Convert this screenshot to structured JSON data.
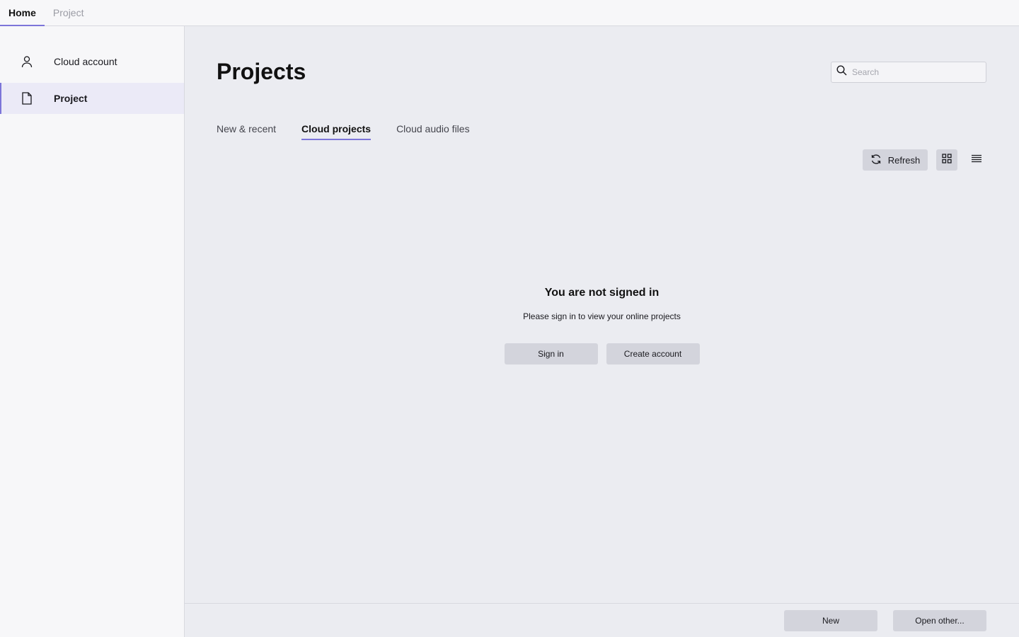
{
  "topbar": {
    "tabs": [
      {
        "label": "Home",
        "active": true
      },
      {
        "label": "Project",
        "active": false
      }
    ]
  },
  "sidebar": {
    "items": [
      {
        "label": "Cloud account",
        "icon": "user-icon",
        "active": false
      },
      {
        "label": "Project",
        "icon": "document-icon",
        "active": true
      }
    ]
  },
  "main": {
    "title": "Projects",
    "search": {
      "placeholder": "Search",
      "value": ""
    },
    "tabs": [
      {
        "label": "New & recent",
        "active": false
      },
      {
        "label": "Cloud projects",
        "active": true
      },
      {
        "label": "Cloud audio files",
        "active": false
      }
    ],
    "toolbar": {
      "refresh_label": "Refresh",
      "view_mode": "grid"
    },
    "empty_state": {
      "title": "You are not signed in",
      "subtitle": "Please sign in to view your online projects",
      "sign_in_label": "Sign in",
      "create_account_label": "Create account"
    }
  },
  "footer": {
    "new_label": "New",
    "open_other_label": "Open other..."
  },
  "colors": {
    "accent": "#7c75d9",
    "button_bg": "#d3d4dc",
    "panel_bg": "#ebecf1",
    "sidebar_bg": "#f7f7f9"
  }
}
